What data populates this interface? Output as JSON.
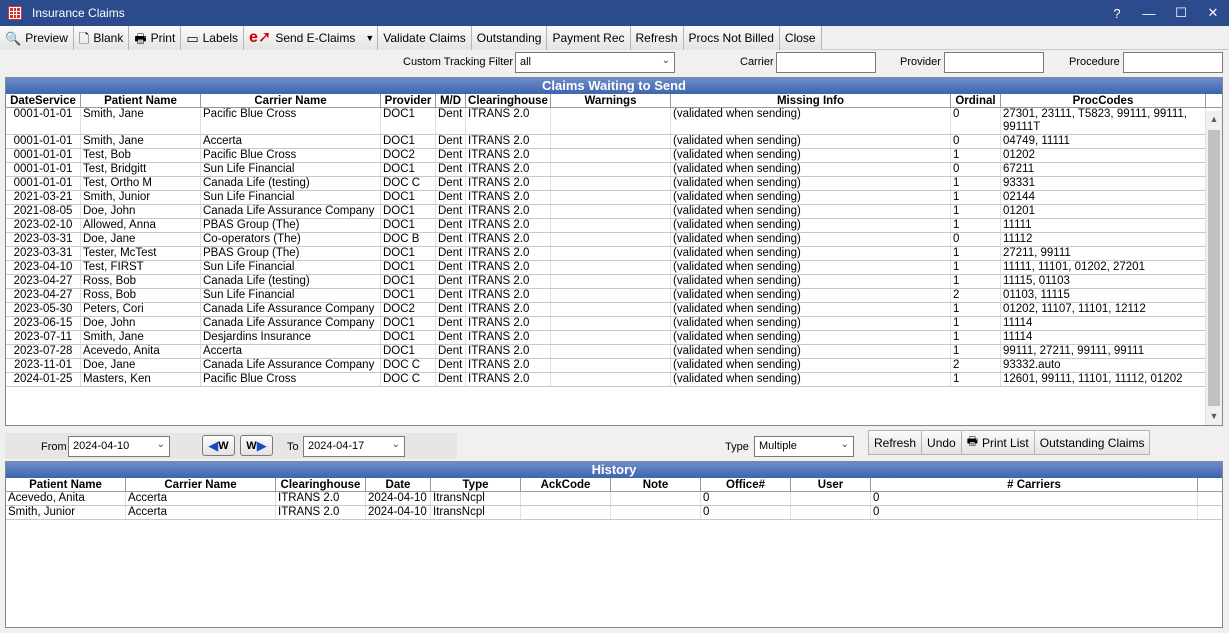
{
  "window": {
    "title": "Insurance Claims",
    "controls": [
      "?",
      "—",
      "☐",
      "✕"
    ]
  },
  "toolbar": {
    "preview": "Preview",
    "blank": "Blank",
    "print": "Print",
    "labels": "Labels",
    "send_eclaims": "Send E-Claims",
    "validate_claims": "Validate Claims",
    "outstanding": "Outstanding",
    "payment_rec": "Payment Rec",
    "refresh": "Refresh",
    "procs_not_billed": "Procs Not Billed",
    "close": "Close"
  },
  "filters": {
    "custom_tracking_label": "Custom Tracking Filter",
    "custom_tracking_value": "all",
    "carrier_label": "Carrier",
    "carrier_value": "",
    "provider_label": "Provider",
    "provider_value": "",
    "procedure_label": "Procedure",
    "procedure_value": ""
  },
  "claims": {
    "title": "Claims Waiting to Send",
    "columns": [
      "DateService",
      "Patient Name",
      "Carrier Name",
      "Provider",
      "M/D",
      "Clearinghouse",
      "Warnings",
      "Missing Info",
      "Ordinal",
      "ProcCodes"
    ],
    "rows": [
      [
        "0001-01-01",
        "Smith, Jane",
        "Pacific Blue Cross",
        "DOC1",
        "Dent",
        "ITRANS 2.0",
        "",
        "(validated when sending)",
        "0",
        "27301, 23111, T5823, 99111, 99111, 99111T"
      ],
      [
        "0001-01-01",
        "Smith, Jane",
        "Accerta",
        "DOC1",
        "Dent",
        "ITRANS 2.0",
        "",
        "(validated when sending)",
        "0",
        "04749, 11111"
      ],
      [
        "0001-01-01",
        "Test, Bob",
        "Pacific Blue Cross",
        "DOC2",
        "Dent",
        "ITRANS 2.0",
        "",
        "(validated when sending)",
        "1",
        "01202"
      ],
      [
        "0001-01-01",
        "Test, Bridgitt",
        "Sun Life Financial",
        "DOC1",
        "Dent",
        "ITRANS 2.0",
        "",
        "(validated when sending)",
        "0",
        "67211"
      ],
      [
        "0001-01-01",
        "Test, Ortho M",
        "Canada Life (testing)",
        "DOC C",
        "Dent",
        "ITRANS 2.0",
        "",
        "(validated when sending)",
        "1",
        "93331"
      ],
      [
        "2021-03-21",
        "Smith, Junior",
        "Sun Life Financial",
        "DOC1",
        "Dent",
        "ITRANS 2.0",
        "",
        "(validated when sending)",
        "1",
        "02144"
      ],
      [
        "2021-08-05",
        "Doe, John",
        "Canada Life Assurance Company",
        "DOC1",
        "Dent",
        "ITRANS 2.0",
        "",
        "(validated when sending)",
        "1",
        "01201"
      ],
      [
        "2023-02-10",
        "Allowed, Anna",
        "PBAS Group (The)",
        "DOC1",
        "Dent",
        "ITRANS 2.0",
        "",
        "(validated when sending)",
        "1",
        "11111"
      ],
      [
        "2023-03-31",
        "Doe, Jane",
        "Co-operators (The)",
        "DOC B",
        "Dent",
        "ITRANS 2.0",
        "",
        "(validated when sending)",
        "0",
        "11112"
      ],
      [
        "2023-03-31",
        "Tester, McTest",
        "PBAS Group (The)",
        "DOC1",
        "Dent",
        "ITRANS 2.0",
        "",
        "(validated when sending)",
        "1",
        "27211, 99111"
      ],
      [
        "2023-04-10",
        "Test, FIRST",
        "Sun Life Financial",
        "DOC1",
        "Dent",
        "ITRANS 2.0",
        "",
        "(validated when sending)",
        "1",
        "11111, 11101, 01202, 27201"
      ],
      [
        "2023-04-27",
        "Ross, Bob",
        "Canada Life (testing)",
        "DOC1",
        "Dent",
        "ITRANS 2.0",
        "",
        "(validated when sending)",
        "1",
        "11115, 01103"
      ],
      [
        "2023-04-27",
        "Ross, Bob",
        "Sun Life Financial",
        "DOC1",
        "Dent",
        "ITRANS 2.0",
        "",
        "(validated when sending)",
        "2",
        "01103, 11115"
      ],
      [
        "2023-05-30",
        "Peters, Cori",
        "Canada Life Assurance Company",
        "DOC2",
        "Dent",
        "ITRANS 2.0",
        "",
        "(validated when sending)",
        "1",
        "01202, 11107, 11101, 12112"
      ],
      [
        "2023-06-15",
        "Doe, John",
        "Canada Life Assurance Company",
        "DOC1",
        "Dent",
        "ITRANS 2.0",
        "",
        "(validated when sending)",
        "1",
        "11114"
      ],
      [
        "2023-07-11",
        "Smith, Jane",
        "Desjardins Insurance",
        "DOC1",
        "Dent",
        "ITRANS 2.0",
        "",
        "(validated when sending)",
        "1",
        "11114"
      ],
      [
        "2023-07-28",
        "Acevedo, Anita",
        "Accerta",
        "DOC1",
        "Dent",
        "ITRANS 2.0",
        "",
        "(validated when sending)",
        "1",
        "99111, 27211, 99111, 99111"
      ],
      [
        "2023-11-01",
        "Doe, Jane",
        "Canada Life Assurance Company",
        "DOC C",
        "Dent",
        "ITRANS 2.0",
        "",
        "(validated when sending)",
        "2",
        "93332.auto"
      ],
      [
        "2024-01-25",
        "Masters, Ken",
        "Pacific Blue Cross",
        "DOC C",
        "Dent",
        "ITRANS 2.0",
        "",
        "(validated when sending)",
        "1",
        "12601, 99111, 11101, 11112, 01202"
      ]
    ]
  },
  "dates": {
    "from_label": "From",
    "from_value": "2024-04-10",
    "to_label": "To",
    "to_value": "2024-04-17",
    "prev_week": "W",
    "next_week": "W"
  },
  "type_filter": {
    "label": "Type",
    "value": "Multiple"
  },
  "history_buttons": {
    "refresh": "Refresh",
    "undo": "Undo",
    "print_list": "Print List",
    "outstanding_claims": "Outstanding Claims"
  },
  "history": {
    "title": "History",
    "columns": [
      "Patient Name",
      "Carrier Name",
      "Clearinghouse",
      "Date",
      "Type",
      "AckCode",
      "Note",
      "Office#",
      "User",
      "# Carriers"
    ],
    "rows": [
      [
        "Acevedo, Anita",
        "Accerta",
        "ITRANS 2.0",
        "2024-04-10",
        "ItransNcpl",
        "",
        "",
        "0",
        "",
        "0"
      ],
      [
        "Smith, Junior",
        "Accerta",
        "ITRANS 2.0",
        "2024-04-10",
        "ItransNcpl",
        "",
        "",
        "0",
        "",
        "0"
      ]
    ]
  }
}
